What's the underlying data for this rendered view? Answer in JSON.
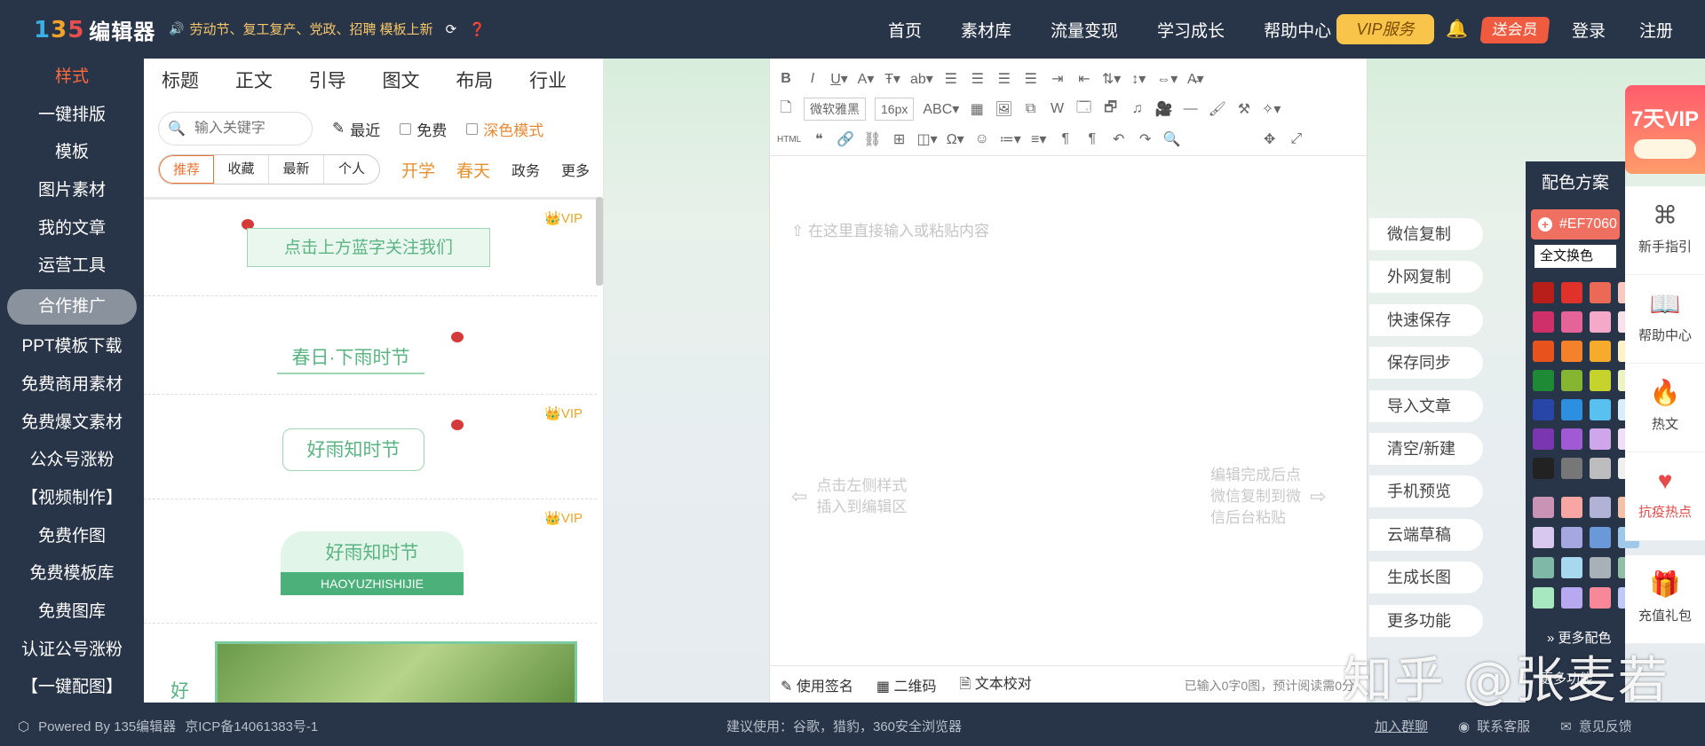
{
  "header": {
    "logo_mark": "135",
    "logo_text": "编辑器",
    "notice": "劳动节、复工复产、党政、招聘 模板上新",
    "nav": [
      "首页",
      "素材库",
      "流量变现",
      "学习成长",
      "帮助中心"
    ],
    "vip": "VIP服务",
    "send_vip": "送会员",
    "login": "登录",
    "register": "注册"
  },
  "sidebar": {
    "items": [
      "样式",
      "一键排版",
      "模板",
      "图片素材",
      "我的文章",
      "运营工具",
      "合作推广",
      "PPT模板下载",
      "免费商用素材",
      "免费爆文素材",
      "公众号涨粉",
      "【视频制作】",
      "免费作图",
      "免费模板库",
      "免费图库",
      "认证公号涨粉",
      "【一键配图】"
    ]
  },
  "style_panel": {
    "categories": [
      "标题",
      "正文",
      "引导",
      "图文",
      "布局",
      "行业"
    ],
    "search_placeholder": "输入关键字",
    "recent": "最近",
    "free": "免费",
    "dark_mode": "深色模式",
    "segments": [
      "推荐",
      "收藏",
      "最新",
      "个人"
    ],
    "tags": [
      "开学",
      "春天"
    ],
    "tags_dark": [
      "政务",
      "更多"
    ],
    "templates": [
      {
        "vip": "VIP",
        "text": "点击上方蓝字关注我们"
      },
      {
        "vip": "",
        "text": "春日·下雨时节"
      },
      {
        "vip": "VIP",
        "text": "好雨知时节"
      },
      {
        "vip": "VIP",
        "text": "好雨知时节",
        "sub": "HAOYUZHISHIJIE"
      },
      {
        "vip": "",
        "text": "好"
      }
    ]
  },
  "editor": {
    "font": "微软雅黑",
    "size": "16px",
    "placeholder": "在这里直接输入或粘贴内容",
    "hint_left": [
      "点击左侧样式",
      "插入到编辑区"
    ],
    "hint_right": [
      "编辑完成后点",
      "微信复制到微",
      "信后台粘贴"
    ],
    "footer": [
      "使用签名",
      "二维码",
      "文本校对"
    ],
    "count": "已输入0字0图，预计阅读需0分"
  },
  "actions": [
    "微信复制",
    "外网复制",
    "快速保存",
    "保存同步",
    "导入文章",
    "清空/新建",
    "手机预览",
    "云端草稿",
    "生成长图",
    "更多功能"
  ],
  "color_panel": {
    "title": "配色方案",
    "hex": "#EF7060",
    "scope": "全文换色",
    "swatches": [
      "#b91f1a",
      "#e0312b",
      "#ec6a55",
      "#f8c9c0",
      "#d0306a",
      "#e4649a",
      "#f3a9c7",
      "#fbe1eb",
      "#e8521c",
      "#f5822a",
      "#f7ab2c",
      "#fff2c8",
      "#1e8a36",
      "#86b532",
      "#c7d32d",
      "#eef3c4",
      "#2845a8",
      "#2d8fe0",
      "#58c1ef",
      "#d8eef9",
      "#7a36b0",
      "#a05ad4",
      "#cfa5ec",
      "#efe0f8",
      "#222222",
      "#777777",
      "#bdbdbd",
      "#efefef"
    ],
    "swatches2": [
      "#c893b4",
      "#f7a6a3",
      "#b1b2d6",
      "#f5c0a8",
      "#d8c8f0",
      "#a5a8e0",
      "#6a98d8",
      "#a0c8e8",
      "#80b8a8",
      "#a8d8f0",
      "#a8b0b8",
      "#90c0a8",
      "#a8e8c0",
      "#b8a8f0",
      "#f88898",
      "#c0c8f8"
    ],
    "more_color": "更多配色",
    "more_func": "更多功能"
  },
  "right_rail": {
    "vip7": "7天VIP",
    "items": [
      {
        "icon": "guide-icon",
        "label": "新手指引"
      },
      {
        "icon": "help-icon",
        "label": "帮助中心"
      },
      {
        "icon": "fire-icon",
        "label": "热文"
      },
      {
        "icon": "heart-icon",
        "label": "抗疫热点"
      },
      {
        "icon": "gift-icon",
        "label": "充值礼包"
      }
    ]
  },
  "footer": {
    "powered": "Powered By 135编辑器",
    "icp": "京ICP备14061383号-1",
    "browser": "建议使用：谷歌，猎豹，360安全浏览器",
    "group": "加入群聊",
    "service": "联系客服",
    "feedback": "意见反馈"
  },
  "watermark": "知乎 @张麦若"
}
